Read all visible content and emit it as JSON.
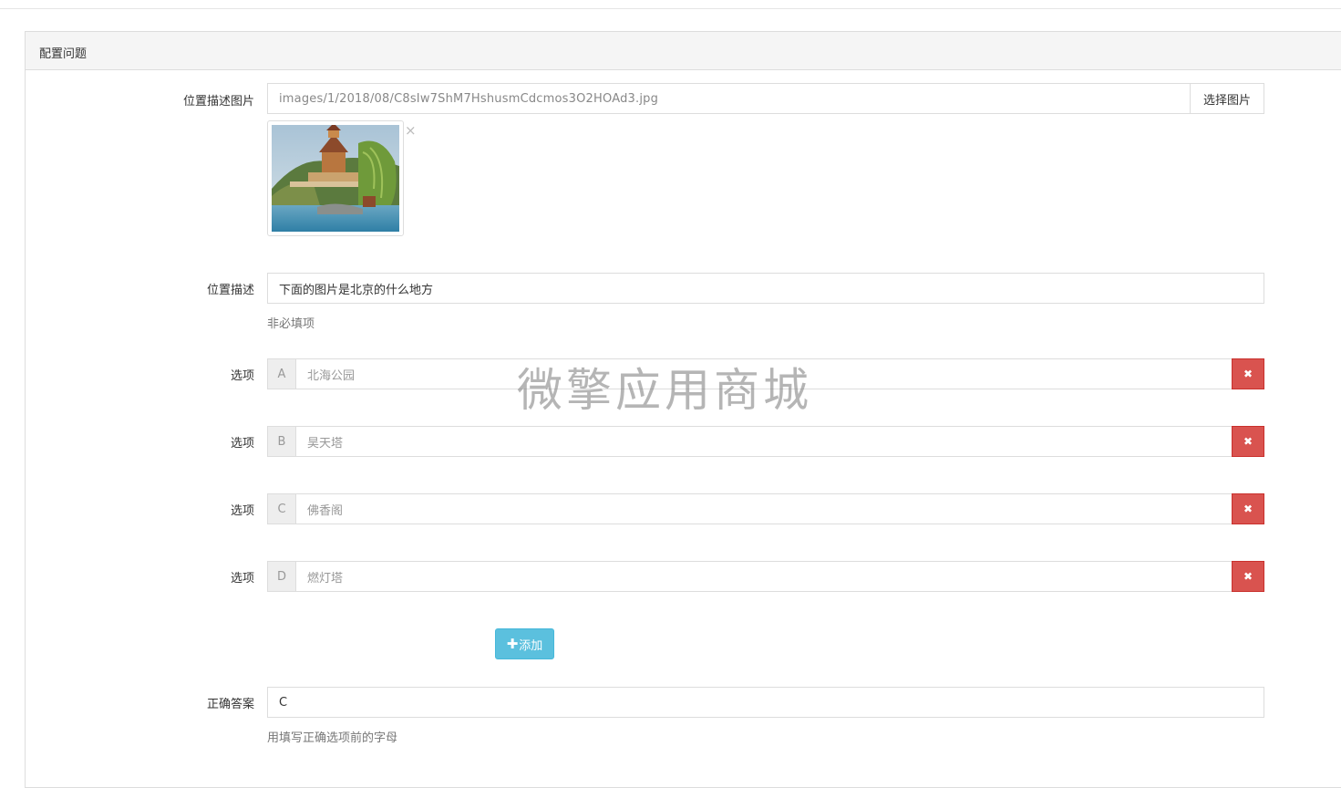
{
  "panel": {
    "title": "配置问题"
  },
  "image_field": {
    "label": "位置描述图片",
    "path": "images/1/2018/08/C8sIw7ShM7HshusmCdcmos3O2HOAd3.jpg",
    "choose_label": "选择图片",
    "remove_symbol": "×"
  },
  "description_field": {
    "label": "位置描述",
    "value": "下面的图片是北京的什么地方",
    "help": "非必填项"
  },
  "options": [
    {
      "label": "选项",
      "letter": "A",
      "value": "北海公园",
      "delete_symbol": "✖"
    },
    {
      "label": "选项",
      "letter": "B",
      "value": "昊天塔",
      "delete_symbol": "✖"
    },
    {
      "label": "选项",
      "letter": "C",
      "value": "佛香阁",
      "delete_symbol": "✖"
    },
    {
      "label": "选项",
      "letter": "D",
      "value": "燃灯塔",
      "delete_symbol": "✖"
    }
  ],
  "add_button": {
    "icon": "plus-icon",
    "plus_symbol": "✚",
    "label": "添加"
  },
  "answer_field": {
    "label": "正确答案",
    "value": "C",
    "help": "用填写正确选项前的字母"
  },
  "watermark": "微擎应用商城",
  "colors": {
    "danger": "#d9534f",
    "info": "#5bc0de",
    "panel_heading_bg": "#f5f5f5",
    "border": "#dddddd"
  }
}
